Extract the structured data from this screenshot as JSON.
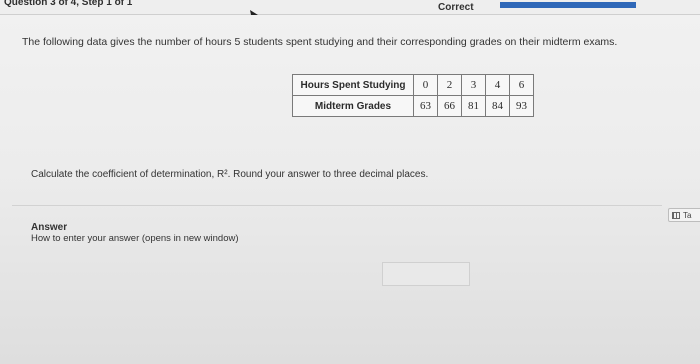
{
  "header": {
    "question_label": "Question 3 of 4, Step 1 of 1",
    "status": "Correct",
    "progress_fraction": 1.0
  },
  "question": {
    "prompt": "The following data gives the number of hours 5 students spent studying and their corresponding grades on their midterm exams.",
    "table": {
      "rows": [
        {
          "label": "Hours Spent Studying",
          "values": [
            "0",
            "2",
            "3",
            "4",
            "6"
          ]
        },
        {
          "label": "Midterm Grades",
          "values": [
            "63",
            "66",
            "81",
            "84",
            "93"
          ]
        }
      ]
    },
    "instruction": "Calculate the coefficient of determination, R². Round your answer to three decimal places."
  },
  "answer": {
    "label": "Answer",
    "help_link": "How to enter your answer (opens in new window)",
    "value": ""
  },
  "side_button": {
    "label": "Ta",
    "icon": "table-icon"
  }
}
